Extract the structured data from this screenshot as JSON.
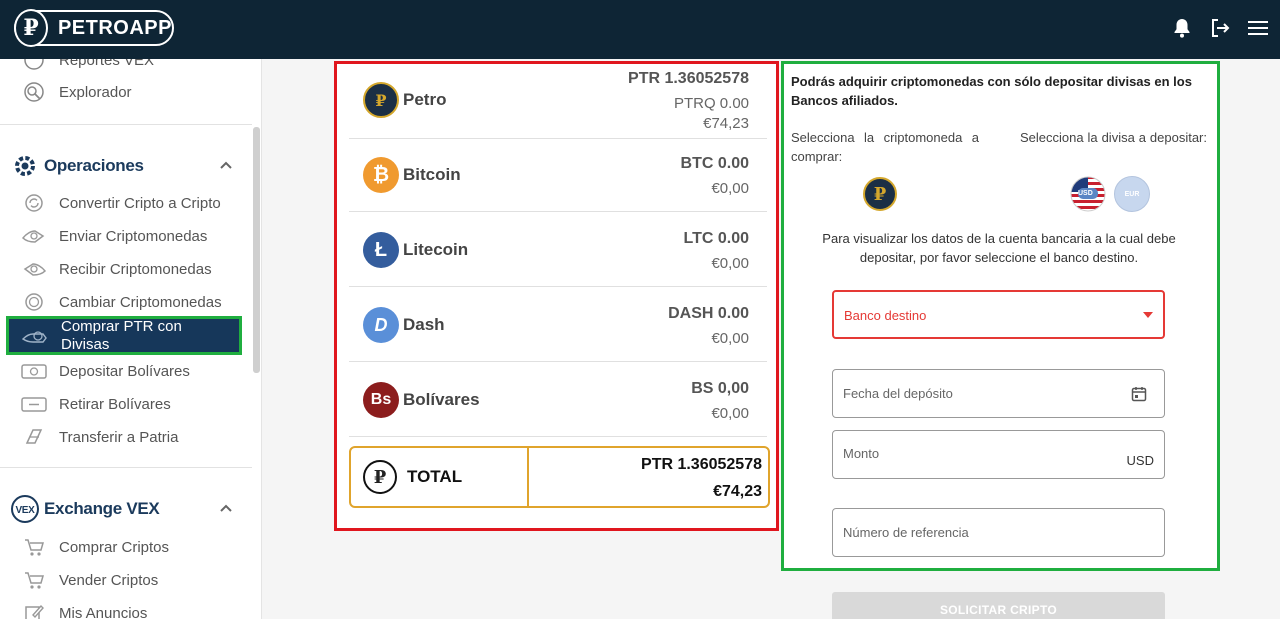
{
  "header": {
    "brand": "PETROAPP",
    "logo_letter": "₽"
  },
  "sidebar": {
    "top_items": [
      {
        "label": "Reportes VEX",
        "icon": "report-icon"
      },
      {
        "label": "Explorador",
        "icon": "explorer-icon"
      }
    ],
    "sections": [
      {
        "title": "Operaciones",
        "icon": "gear-icon",
        "items": [
          {
            "label": "Convertir Cripto a Cripto",
            "icon": "convert-icon"
          },
          {
            "label": "Enviar Criptomonedas",
            "icon": "send-icon"
          },
          {
            "label": "Recibir Criptomonedas",
            "icon": "receive-icon"
          },
          {
            "label": "Cambiar Criptomonedas",
            "icon": "exchange-coin-icon"
          },
          {
            "label": "Comprar PTR con Divisas",
            "icon": "buy-ptr-icon",
            "active": true
          },
          {
            "label": "Depositar Bolívares",
            "icon": "deposit-icon"
          },
          {
            "label": "Retirar Bolívares",
            "icon": "withdraw-icon"
          },
          {
            "label": "Transferir a Patria",
            "icon": "transfer-icon"
          }
        ]
      },
      {
        "title": "Exchange VEX",
        "icon": "vex-icon",
        "icon_text": "VEX",
        "items": [
          {
            "label": "Comprar Criptos",
            "icon": "cart-icon"
          },
          {
            "label": "Vender Criptos",
            "icon": "cart-icon"
          },
          {
            "label": "Mis Anuncios",
            "icon": "edit-icon"
          }
        ]
      }
    ]
  },
  "balances": [
    {
      "name": "Petro",
      "amount": "PTR 1.36052578",
      "sub1": "PTRQ 0.00",
      "sub2": "€74,23",
      "color": "#1b2f45",
      "glyph": "₽"
    },
    {
      "name": "Bitcoin",
      "amount": "BTC 0.00",
      "sub1": "€0,00",
      "color": "#f09a2f",
      "glyph": "₿"
    },
    {
      "name": "Litecoin",
      "amount": "LTC 0.00",
      "sub1": "€0,00",
      "color": "#345d9d",
      "glyph": "Ł"
    },
    {
      "name": "Dash",
      "amount": "DASH 0.00",
      "sub1": "€0,00",
      "color": "#5a8fd8",
      "glyph": "D"
    },
    {
      "name": "Bolívares",
      "amount": "BS 0,00",
      "sub1": "€0,00",
      "color": "#8c1d1d",
      "glyph": "Bs"
    }
  ],
  "total": {
    "label": "TOTAL",
    "ptr": "PTR 1.36052578",
    "eur": "€74,23",
    "glyph": "₽"
  },
  "form": {
    "heading": "Podrás adquirir criptomonedas con sólo depositar divisas en los Bancos afiliados.",
    "select_crypto_label": "Selecciona la criptomoneda a comprar:",
    "select_currency_label": "Selecciona la divisa a depositar:",
    "currency_usd": "USD",
    "currency_eur": "EUR",
    "info": "Para visualizar los datos de la cuenta bancaria a la cual debe depositar, por favor seleccione el banco destino.",
    "bank_placeholder": "Banco destino",
    "date_placeholder": "Fecha del depósito",
    "amount_placeholder": "Monto",
    "amount_suffix": "USD",
    "reference_placeholder": "Número de referencia",
    "submit_label": "SOLICITAR CRIPTO"
  },
  "colors": {
    "header_bg": "#0e2535",
    "active_bg": "#16375a",
    "error": "#e53935",
    "total_border": "#e0a42c",
    "highlight_red": "#e0161e",
    "highlight_green": "#1fae3f"
  }
}
